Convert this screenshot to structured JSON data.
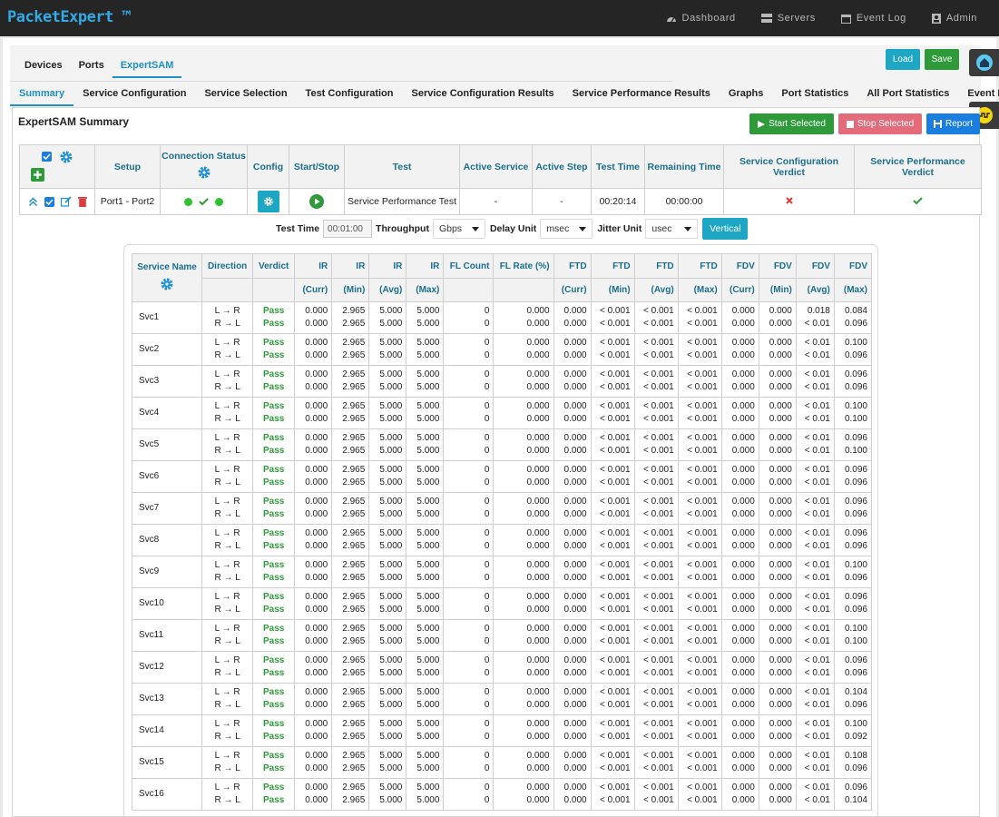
{
  "app": {
    "title": "PacketExpert ™"
  },
  "nav": [
    {
      "label": "Dashboard",
      "icon": "dashboard-icon"
    },
    {
      "label": "Servers",
      "icon": "servers-icon"
    },
    {
      "label": "Event Log",
      "icon": "calendar-icon"
    },
    {
      "label": "Admin",
      "icon": "admin-icon"
    }
  ],
  "tabs1": [
    "Devices",
    "Ports",
    "ExpertSAM"
  ],
  "tabs1_active": 2,
  "tabs2": [
    "Summary",
    "Service Configuration",
    "Service Selection",
    "Test Configuration",
    "Service Configuration Results",
    "Service Performance Results",
    "Graphs",
    "Port Statistics",
    "All Port Statistics",
    "Event Log"
  ],
  "tabs2_active": 0,
  "buttons": {
    "load": "Load",
    "save": "Save",
    "start": "Start Selected",
    "stop": "Stop Selected",
    "report": "Report"
  },
  "colors": {
    "primary": "#1ea7c4",
    "success": "#2e9a3a",
    "danger": "#e36b7a",
    "report": "#1a7de0"
  },
  "panel": {
    "title": "ExpertSAM Summary"
  },
  "summary_table": {
    "headers": {
      "setup": "Setup",
      "conn": "Connection Status",
      "config": "Config",
      "startstop": "Start/Stop",
      "test": "Test",
      "active_service": "Active Service",
      "active_step": "Active Step",
      "test_time": "Test Time",
      "remaining": "Remaining Time",
      "scv": "Service Configuration Verdict",
      "spv": "Service Performance Verdict"
    },
    "row": {
      "setup": "Port1 - Port2",
      "test": "Service Performance Test",
      "active_service": "-",
      "active_step": "-",
      "test_time": "00:20:14",
      "remaining": "00:00:00",
      "scv": "fail",
      "spv": "pass"
    }
  },
  "params": {
    "test_time_label": "Test Time",
    "test_time_value": "00:01:00",
    "throughput_label": "Throughput",
    "throughput_value": "Gbps",
    "delay_label": "Delay Unit",
    "delay_value": "msec",
    "jitter_label": "Jitter Unit",
    "jitter_value": "usec",
    "vertical": "Vertical"
  },
  "results": {
    "headers": [
      [
        "Service Name",
        ""
      ],
      [
        "Direction",
        ""
      ],
      [
        "Verdict",
        ""
      ],
      [
        "IR",
        "(Curr)"
      ],
      [
        "IR",
        "(Min)"
      ],
      [
        "IR",
        "(Avg)"
      ],
      [
        "IR",
        "(Max)"
      ],
      [
        "FL Count",
        ""
      ],
      [
        "FL Rate (%)",
        ""
      ],
      [
        "FTD",
        "(Curr)"
      ],
      [
        "FTD",
        "(Min)"
      ],
      [
        "FTD",
        "(Avg)"
      ],
      [
        "FTD",
        "(Max)"
      ],
      [
        "FDV",
        "(Curr)"
      ],
      [
        "FDV",
        "(Min)"
      ],
      [
        "FDV",
        "(Avg)"
      ],
      [
        "FDV",
        "(Max)"
      ]
    ],
    "dir_lr": "L → R",
    "dir_rl": "R → L",
    "rows": [
      {
        "name": "Svc1",
        "lr": [
          "Pass",
          "0.000",
          "2.965",
          "5.000",
          "5.000",
          "0",
          "0.000",
          "0.000",
          "< 0.001",
          "< 0.001",
          "< 0.001",
          "0.000",
          "0.000",
          "0.018",
          "0.084"
        ],
        "rl": [
          "Pass",
          "0.000",
          "2.965",
          "5.000",
          "5.000",
          "0",
          "0.000",
          "0.000",
          "< 0.001",
          "< 0.001",
          "< 0.001",
          "0.000",
          "0.000",
          "< 0.01",
          "0.096"
        ]
      },
      {
        "name": "Svc2",
        "lr": [
          "Pass",
          "0.000",
          "2.965",
          "5.000",
          "5.000",
          "0",
          "0.000",
          "0.000",
          "< 0.001",
          "< 0.001",
          "< 0.001",
          "0.000",
          "0.000",
          "< 0.01",
          "0.100"
        ],
        "rl": [
          "Pass",
          "0.000",
          "2.965",
          "5.000",
          "5.000",
          "0",
          "0.000",
          "0.000",
          "< 0.001",
          "< 0.001",
          "< 0.001",
          "0.000",
          "0.000",
          "< 0.01",
          "0.096"
        ]
      },
      {
        "name": "Svc3",
        "lr": [
          "Pass",
          "0.000",
          "2.965",
          "5.000",
          "5.000",
          "0",
          "0.000",
          "0.000",
          "< 0.001",
          "< 0.001",
          "< 0.001",
          "0.000",
          "0.000",
          "< 0.01",
          "0.096"
        ],
        "rl": [
          "Pass",
          "0.000",
          "2.965",
          "5.000",
          "5.000",
          "0",
          "0.000",
          "0.000",
          "< 0.001",
          "< 0.001",
          "< 0.001",
          "0.000",
          "0.000",
          "< 0.01",
          "0.096"
        ]
      },
      {
        "name": "Svc4",
        "lr": [
          "Pass",
          "0.000",
          "2.965",
          "5.000",
          "5.000",
          "0",
          "0.000",
          "0.000",
          "< 0.001",
          "< 0.001",
          "< 0.001",
          "0.000",
          "0.000",
          "< 0.01",
          "0.100"
        ],
        "rl": [
          "Pass",
          "0.000",
          "2.965",
          "5.000",
          "5.000",
          "0",
          "0.000",
          "0.000",
          "< 0.001",
          "< 0.001",
          "< 0.001",
          "0.000",
          "0.000",
          "< 0.01",
          "0.100"
        ]
      },
      {
        "name": "Svc5",
        "lr": [
          "Pass",
          "0.000",
          "2.965",
          "5.000",
          "5.000",
          "0",
          "0.000",
          "0.000",
          "< 0.001",
          "< 0.001",
          "< 0.001",
          "0.000",
          "0.000",
          "< 0.01",
          "0.096"
        ],
        "rl": [
          "Pass",
          "0.000",
          "2.965",
          "5.000",
          "5.000",
          "0",
          "0.000",
          "0.000",
          "< 0.001",
          "< 0.001",
          "< 0.001",
          "0.000",
          "0.000",
          "< 0.01",
          "0.100"
        ]
      },
      {
        "name": "Svc6",
        "lr": [
          "Pass",
          "0.000",
          "2.965",
          "5.000",
          "5.000",
          "0",
          "0.000",
          "0.000",
          "< 0.001",
          "< 0.001",
          "< 0.001",
          "0.000",
          "0.000",
          "< 0.01",
          "0.096"
        ],
        "rl": [
          "Pass",
          "0.000",
          "2.965",
          "5.000",
          "5.000",
          "0",
          "0.000",
          "0.000",
          "< 0.001",
          "< 0.001",
          "< 0.001",
          "0.000",
          "0.000",
          "< 0.01",
          "0.096"
        ]
      },
      {
        "name": "Svc7",
        "lr": [
          "Pass",
          "0.000",
          "2.965",
          "5.000",
          "5.000",
          "0",
          "0.000",
          "0.000",
          "< 0.001",
          "< 0.001",
          "< 0.001",
          "0.000",
          "0.000",
          "< 0.01",
          "0.096"
        ],
        "rl": [
          "Pass",
          "0.000",
          "2.965",
          "5.000",
          "5.000",
          "0",
          "0.000",
          "0.000",
          "< 0.001",
          "< 0.001",
          "< 0.001",
          "0.000",
          "0.000",
          "< 0.01",
          "0.096"
        ]
      },
      {
        "name": "Svc8",
        "lr": [
          "Pass",
          "0.000",
          "2.965",
          "5.000",
          "5.000",
          "0",
          "0.000",
          "0.000",
          "< 0.001",
          "< 0.001",
          "< 0.001",
          "0.000",
          "0.000",
          "< 0.01",
          "0.096"
        ],
        "rl": [
          "Pass",
          "0.000",
          "2.965",
          "5.000",
          "5.000",
          "0",
          "0.000",
          "0.000",
          "< 0.001",
          "< 0.001",
          "< 0.001",
          "0.000",
          "0.000",
          "< 0.01",
          "0.096"
        ]
      },
      {
        "name": "Svc9",
        "lr": [
          "Pass",
          "0.000",
          "2.965",
          "5.000",
          "5.000",
          "0",
          "0.000",
          "0.000",
          "< 0.001",
          "< 0.001",
          "< 0.001",
          "0.000",
          "0.000",
          "< 0.01",
          "0.100"
        ],
        "rl": [
          "Pass",
          "0.000",
          "2.965",
          "5.000",
          "5.000",
          "0",
          "0.000",
          "0.000",
          "< 0.001",
          "< 0.001",
          "< 0.001",
          "0.000",
          "0.000",
          "< 0.01",
          "0.096"
        ]
      },
      {
        "name": "Svc10",
        "lr": [
          "Pass",
          "0.000",
          "2.965",
          "5.000",
          "5.000",
          "0",
          "0.000",
          "0.000",
          "< 0.001",
          "< 0.001",
          "< 0.001",
          "0.000",
          "0.000",
          "< 0.01",
          "0.096"
        ],
        "rl": [
          "Pass",
          "0.000",
          "2.965",
          "5.000",
          "5.000",
          "0",
          "0.000",
          "0.000",
          "< 0.001",
          "< 0.001",
          "< 0.001",
          "0.000",
          "0.000",
          "< 0.01",
          "0.096"
        ]
      },
      {
        "name": "Svc11",
        "lr": [
          "Pass",
          "0.000",
          "2.965",
          "5.000",
          "5.000",
          "0",
          "0.000",
          "0.000",
          "< 0.001",
          "< 0.001",
          "< 0.001",
          "0.000",
          "0.000",
          "< 0.01",
          "0.100"
        ],
        "rl": [
          "Pass",
          "0.000",
          "2.965",
          "5.000",
          "5.000",
          "0",
          "0.000",
          "0.000",
          "< 0.001",
          "< 0.001",
          "< 0.001",
          "0.000",
          "0.000",
          "< 0.01",
          "0.100"
        ]
      },
      {
        "name": "Svc12",
        "lr": [
          "Pass",
          "0.000",
          "2.965",
          "5.000",
          "5.000",
          "0",
          "0.000",
          "0.000",
          "< 0.001",
          "< 0.001",
          "< 0.001",
          "0.000",
          "0.000",
          "< 0.01",
          "0.096"
        ],
        "rl": [
          "Pass",
          "0.000",
          "2.965",
          "5.000",
          "5.000",
          "0",
          "0.000",
          "0.000",
          "< 0.001",
          "< 0.001",
          "< 0.001",
          "0.000",
          "0.000",
          "< 0.01",
          "0.096"
        ]
      },
      {
        "name": "Svc13",
        "lr": [
          "Pass",
          "0.000",
          "2.965",
          "5.000",
          "5.000",
          "0",
          "0.000",
          "0.000",
          "< 0.001",
          "< 0.001",
          "< 0.001",
          "0.000",
          "0.000",
          "< 0.01",
          "0.104"
        ],
        "rl": [
          "Pass",
          "0.000",
          "2.965",
          "5.000",
          "5.000",
          "0",
          "0.000",
          "0.000",
          "< 0.001",
          "< 0.001",
          "< 0.001",
          "0.000",
          "0.000",
          "< 0.01",
          "0.096"
        ]
      },
      {
        "name": "Svc14",
        "lr": [
          "Pass",
          "0.000",
          "2.965",
          "5.000",
          "5.000",
          "0",
          "0.000",
          "0.000",
          "< 0.001",
          "< 0.001",
          "< 0.001",
          "0.000",
          "0.000",
          "< 0.01",
          "0.100"
        ],
        "rl": [
          "Pass",
          "0.000",
          "2.965",
          "5.000",
          "5.000",
          "0",
          "0.000",
          "0.000",
          "< 0.001",
          "< 0.001",
          "< 0.001",
          "0.000",
          "0.000",
          "< 0.01",
          "0.092"
        ]
      },
      {
        "name": "Svc15",
        "lr": [
          "Pass",
          "0.000",
          "2.965",
          "5.000",
          "5.000",
          "0",
          "0.000",
          "0.000",
          "< 0.001",
          "< 0.001",
          "< 0.001",
          "0.000",
          "0.000",
          "< 0.01",
          "0.108"
        ],
        "rl": [
          "Pass",
          "0.000",
          "2.965",
          "5.000",
          "5.000",
          "0",
          "0.000",
          "0.000",
          "< 0.001",
          "< 0.001",
          "< 0.001",
          "0.000",
          "0.000",
          "< 0.01",
          "0.096"
        ]
      },
      {
        "name": "Svc16",
        "lr": [
          "Pass",
          "0.000",
          "2.965",
          "5.000",
          "5.000",
          "0",
          "0.000",
          "0.000",
          "< 0.001",
          "< 0.001",
          "< 0.001",
          "0.000",
          "0.000",
          "< 0.01",
          "0.096"
        ],
        "rl": [
          "Pass",
          "0.000",
          "2.965",
          "5.000",
          "5.000",
          "0",
          "0.000",
          "0.000",
          "< 0.001",
          "< 0.001",
          "< 0.001",
          "0.000",
          "0.000",
          "< 0.01",
          "0.104"
        ]
      }
    ]
  }
}
